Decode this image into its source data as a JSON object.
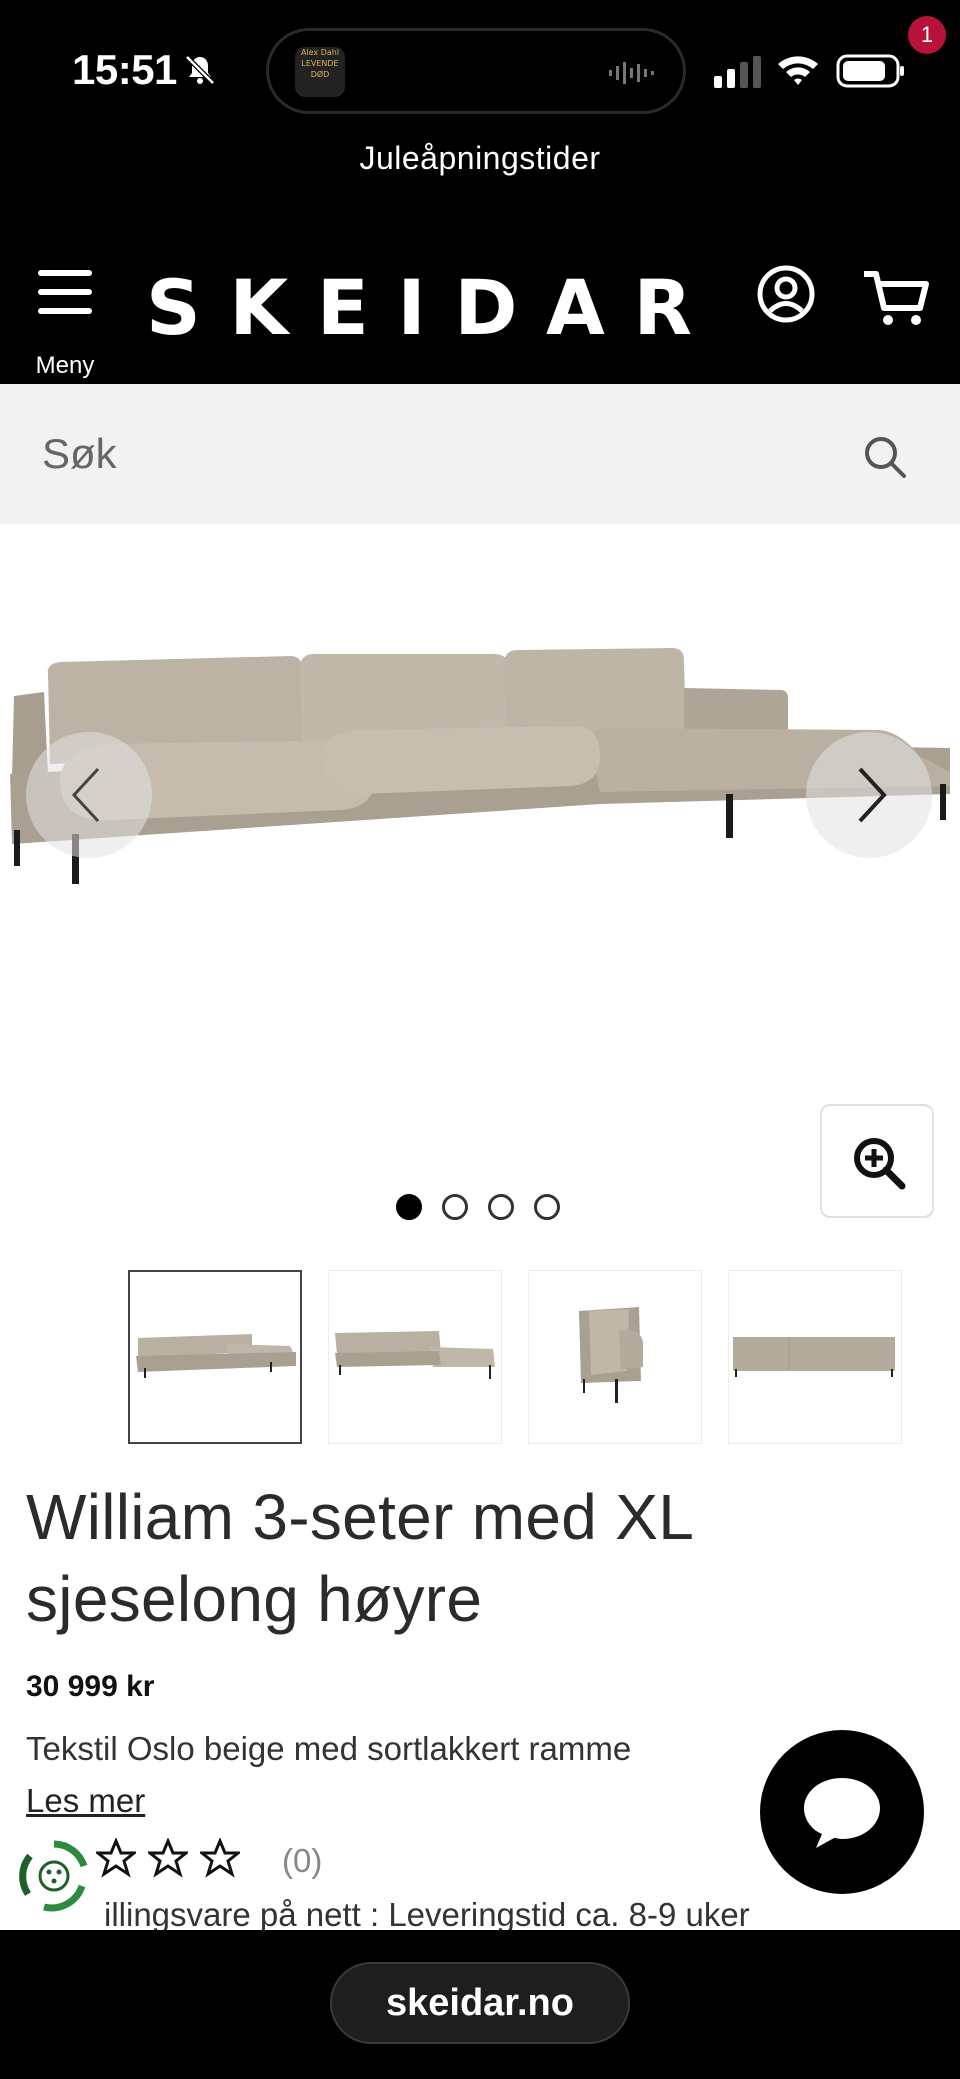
{
  "status_bar": {
    "time": "15:51",
    "island_thumb_lines": [
      "Alex Dahl",
      "LEVENDE",
      "DØD"
    ]
  },
  "banner": {
    "text": "Juleåpningstider"
  },
  "header": {
    "menu_label": "Meny",
    "logo": "SKEIDAR",
    "cart_count": "1"
  },
  "search": {
    "placeholder": "Søk"
  },
  "gallery": {
    "image_count": 4,
    "active_index": 0
  },
  "product": {
    "title": "William 3-seter med XL sjeselong høyre",
    "price": "30 999 kr",
    "description": "Tekstil Oslo beige med sortlakkert ramme",
    "read_more": "Les mer",
    "rating_count": "(0)",
    "rating_stars": 0,
    "delivery": "illingsvare på nett : Leveringstid ca. 8-9 uker"
  },
  "browser": {
    "url": "skeidar.no"
  },
  "colors": {
    "header_bg": "#000000",
    "badge": "#b8123a",
    "search_bg": "#f2f2f2",
    "sofa": "#b4ab9c"
  }
}
